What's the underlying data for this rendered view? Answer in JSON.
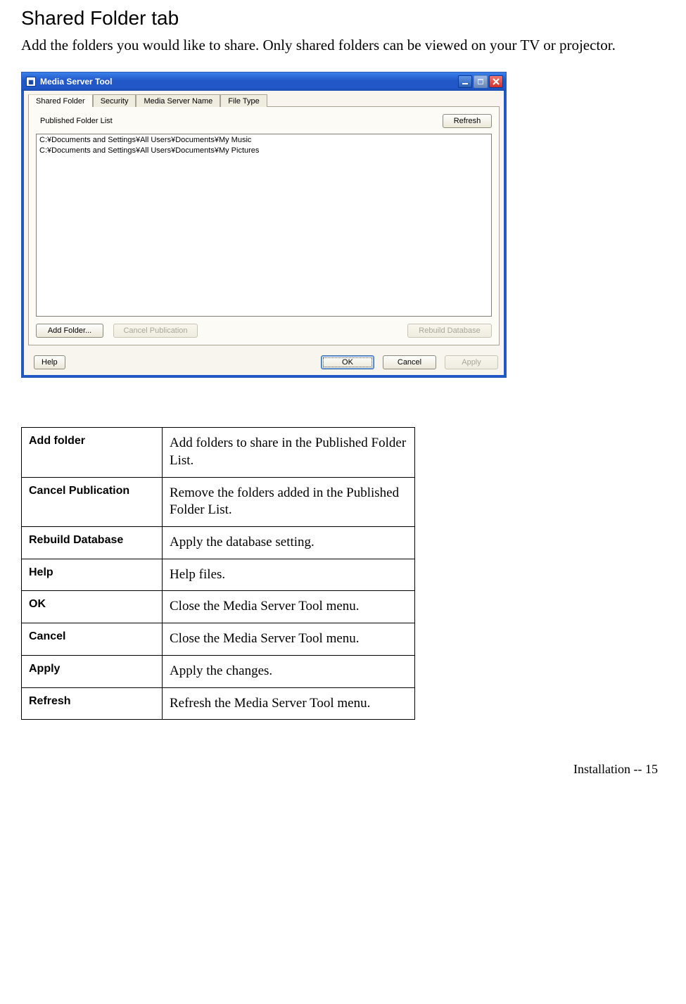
{
  "heading": "Shared Folder tab",
  "intro": "Add the folders you would like to share. Only shared folders can be viewed on your TV or projector.",
  "screenshot": {
    "window_title": "Media Server Tool",
    "tabs": {
      "shared": "Shared Folder",
      "security": "Security",
      "server_name": "Media Server Name",
      "file_type": "File Type"
    },
    "pfl_label": "Published Folder List",
    "refresh_btn": "Refresh",
    "folder_list": [
      "C:¥Documents and Settings¥All Users¥Documents¥My Music",
      "C:¥Documents and Settings¥All Users¥Documents¥My Pictures"
    ],
    "add_folder_btn": "Add Folder...",
    "cancel_pub_btn": "Cancel Publication",
    "rebuild_db_btn": "Rebuild Database",
    "help_btn": "Help",
    "ok_btn": "OK",
    "cancel_btn": "Cancel",
    "apply_btn": "Apply"
  },
  "definitions": [
    {
      "term": "Add folder",
      "desc": "Add folders to share in the Published Folder List."
    },
    {
      "term": "Cancel Publication",
      "desc": "Remove the folders added in the Published Folder List."
    },
    {
      "term": "Rebuild Database",
      "desc": "Apply the database setting."
    },
    {
      "term": "Help",
      "desc": "Help files."
    },
    {
      "term": "OK",
      "desc": "Close the Media Server Tool menu."
    },
    {
      "term": "Cancel",
      "desc": "Close the Media Server Tool menu."
    },
    {
      "term": "Apply",
      "desc": "Apply the changes."
    },
    {
      "term": "Refresh",
      "desc": "Refresh the Media Server Tool menu."
    }
  ],
  "footer": "Installation  --  15"
}
